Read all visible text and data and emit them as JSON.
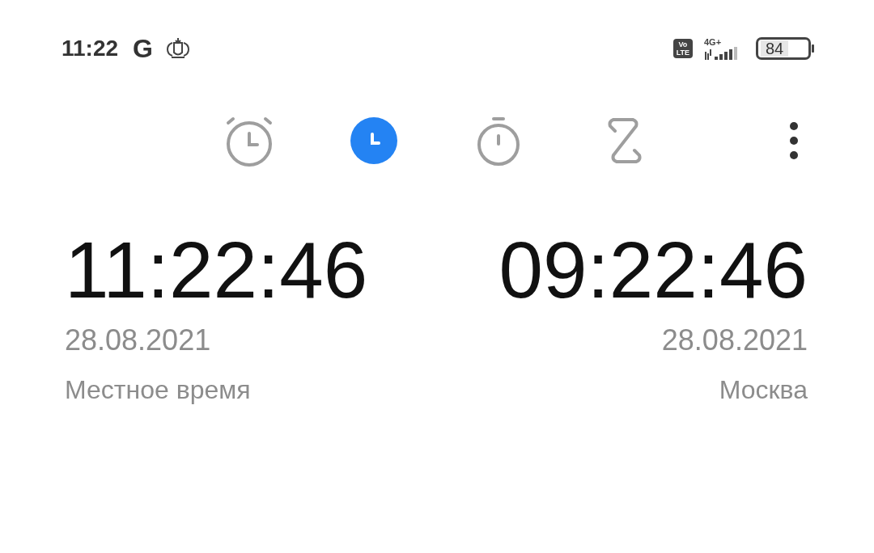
{
  "status_bar": {
    "time": "11:22",
    "google": "G",
    "volte": [
      "Vo",
      "LTE"
    ],
    "network": "4G+",
    "battery": "84"
  },
  "tabs": [
    {
      "kind": "alarm",
      "selected": false
    },
    {
      "kind": "clock",
      "selected": true
    },
    {
      "kind": "stopwatch",
      "selected": false
    },
    {
      "kind": "timer",
      "selected": false
    }
  ],
  "clocks": [
    {
      "time": "11:22:46",
      "date": "28.08.2021",
      "label": "Местное время"
    },
    {
      "time": "09:22:46",
      "date": "28.08.2021",
      "label": "Москва"
    }
  ]
}
